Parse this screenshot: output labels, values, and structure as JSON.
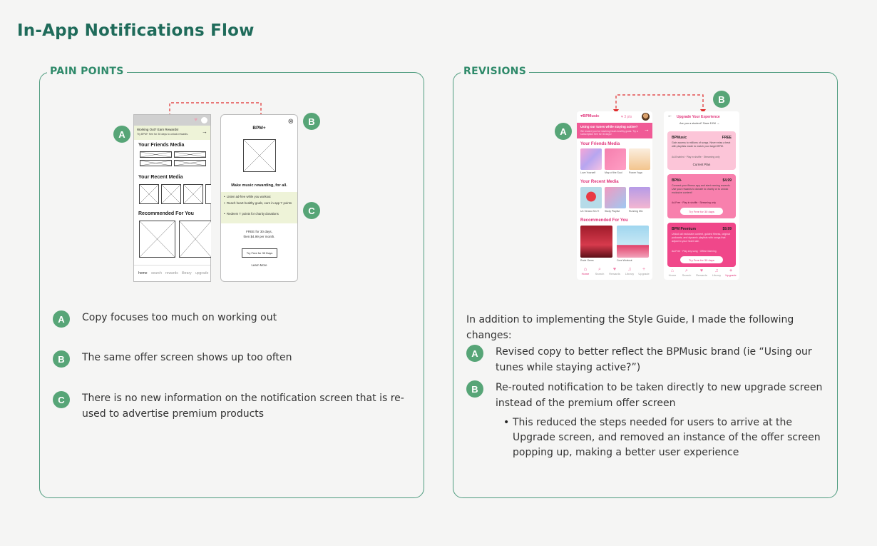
{
  "page_title": "In-App Notifications Flow",
  "pain_points": {
    "label": "PAIN POINTS",
    "items": [
      {
        "badge": "A",
        "text": "Copy focuses too much on working out"
      },
      {
        "badge": "B",
        "text": "The same offer screen shows up too often"
      },
      {
        "badge": "C",
        "line1": "There is no new information on the notification screen that is re-",
        "line2": "used to advertise premium products"
      }
    ],
    "mock": {
      "callouts": [
        "A",
        "B",
        "C"
      ],
      "home": {
        "banner_title": "Working Out? Earn Rewards!",
        "banner_sub": "Try BPM+ free for 30 days to unlock rewards.",
        "arrow": "→",
        "friends": "Your Friends Media",
        "recent": "Your Recent Media",
        "recommended": "Recommended For You",
        "nav": [
          "home",
          "search",
          "rewards",
          "library",
          "upgrade"
        ]
      },
      "offer": {
        "close": "⊗",
        "title": "BPM+",
        "headline": "Make music rewarding, for all.",
        "bullets": [
          "Listen ad-free while you workout",
          "Reach heart-healthy goals, earn in-app 'I' points",
          "Redeem 'I' points for charity donations"
        ],
        "price1": "FREE for 30 days,",
        "price2": "then $4.99 per month.",
        "cta": "Try Free for 30 Days",
        "learn": "Learn More"
      }
    }
  },
  "revisions": {
    "label": "REVISIONS",
    "intro": "In addition to implementing the Style Guide,  I made the following changes:",
    "items": [
      {
        "badge": "A",
        "line1": "Revised copy to better reflect the  BPMusic brand (ie “Using our",
        "line2": "tunes while staying active?”)"
      },
      {
        "badge": "B",
        "line1": "Re-routed notification to be taken directly to new upgrade screen",
        "line2": "instead of the premium offer screen"
      }
    ],
    "bullet": {
      "line1": "This reduced the steps needed for users to arrive at the",
      "line2": "Upgrade screen, and removed an instance of the offer screen",
      "line3": "popping up, making a better user experience"
    },
    "mock": {
      "callouts": [
        "A",
        "B"
      ],
      "home": {
        "logo": "BPMusic",
        "points": "♥ 3 pts",
        "banner_title": "Using our tunes while staying active?",
        "banner_sub": "We reward you for reaching heart-healthy goals. Try a subscription free for 30 days!",
        "arrow": "→",
        "friends": "Your Friends Media",
        "recent": "Your Recent Media",
        "recommended": "Recommended For You",
        "friend_captions": [
          "Love Yourself",
          "Map of the Soul",
          "Power Yoga"
        ],
        "recent_captions": [
          "Un Verano Sin Ti",
          "Study Playlist",
          "Running Mix"
        ],
        "rec_captions": [
          "Rude Gems",
          "Core Workout"
        ],
        "nav": [
          "Home",
          "Search",
          "Rewards",
          "Library",
          "Upgrade"
        ]
      },
      "upgrade": {
        "back": "←",
        "title": "Upgrade Your Experience",
        "student": "Are you a student? Save 15%!",
        "plans": [
          {
            "name": "BPMusic",
            "price": "FREE",
            "desc": "Gain access to millions of songs. Never miss a beat with playlists made to match your target BPM.",
            "features": "Ad-Enabled · Play in shuffle · Streaming only",
            "button": "Current Plan"
          },
          {
            "name": "BPM+",
            "price": "$4.99",
            "desc": "Connect your fitness app and start earning rewards. Use your rewards to donate to charity or to unlock exclusive content!",
            "features": "Ad-Free · Play in shuffle · Streaming only",
            "button": "Try Free for 30 days"
          },
          {
            "name": "BPM Premium",
            "price": "$9.99",
            "desc": "Unlock all exclusive content, guided fitness, original podcasts, and dynamic playlists with songs that adjust to your heart rate.",
            "features": "Ad-Free · Play any song · Offline listening",
            "button": "Try Free for 30 days"
          }
        ]
      }
    }
  },
  "colors": {
    "accent_green": "#57a577",
    "panel_border": "#4f9c7f",
    "title_green": "#1f6b5a",
    "brand_pink": "#e0337a",
    "wire_banner": "#eef3d8",
    "arrow_red": "#e02d2d"
  }
}
